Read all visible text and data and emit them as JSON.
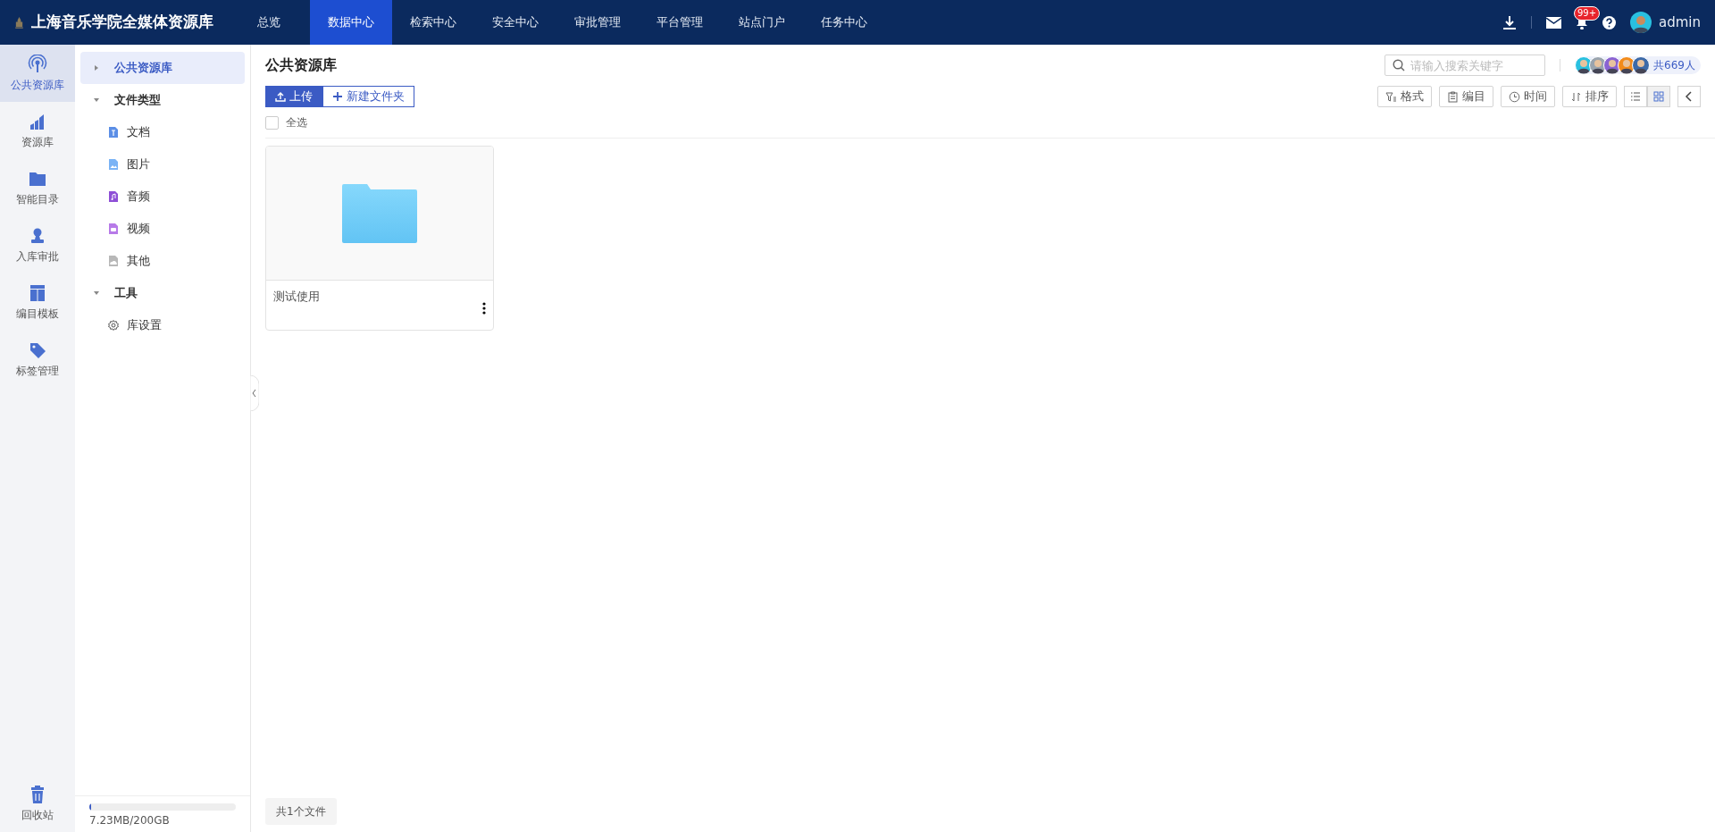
{
  "app": {
    "title": "上海音乐学院全媒体资源库"
  },
  "nav": [
    {
      "label": "总览",
      "selected": false
    },
    {
      "label": "数据中心",
      "selected": true
    },
    {
      "label": "检索中心",
      "selected": false
    },
    {
      "label": "安全中心",
      "selected": false
    },
    {
      "label": "审批管理",
      "selected": false
    },
    {
      "label": "平台管理",
      "selected": false
    },
    {
      "label": "站点门户",
      "selected": false
    },
    {
      "label": "任务中心",
      "selected": false
    }
  ],
  "header_right": {
    "notification_badge": "99+",
    "user": "admin"
  },
  "rail": [
    {
      "label": "公共资源库",
      "kind": "broadcast",
      "selected": true
    },
    {
      "label": "资源库",
      "kind": "chart",
      "selected": false
    },
    {
      "label": "智能目录",
      "kind": "folder",
      "selected": false
    },
    {
      "label": "入库审批",
      "kind": "stamp",
      "selected": false
    },
    {
      "label": "编目模板",
      "kind": "template",
      "selected": false
    },
    {
      "label": "标签管理",
      "kind": "tag",
      "selected": false
    }
  ],
  "rail_bottom": {
    "label": "回收站"
  },
  "tree": [
    {
      "label": "公共资源库",
      "selected": true,
      "expanded": false
    },
    {
      "label": "文件类型",
      "selected": false,
      "expanded": true,
      "children": [
        {
          "label": "文档",
          "kind": "doc",
          "selected": false
        },
        {
          "label": "图片",
          "kind": "image",
          "selected": false
        },
        {
          "label": "音频",
          "kind": "audio",
          "selected": false
        },
        {
          "label": "视频",
          "kind": "video",
          "selected": false
        },
        {
          "label": "其他",
          "kind": "other",
          "selected": false
        }
      ]
    },
    {
      "label": "工具",
      "selected": false,
      "expanded": true,
      "children": [
        {
          "label": "库设置",
          "kind": "gear",
          "selected": false
        }
      ]
    }
  ],
  "storage": {
    "level": 4e-05,
    "reading": "7.23MB/200GB"
  },
  "main": {
    "title": "公共资源库",
    "search": {
      "placeholder": "请输入搜索关键字"
    },
    "members": "共669人",
    "actions": [
      {
        "label": "上传",
        "kind": "upload"
      },
      {
        "label": "新建文件夹",
        "kind": "plus"
      }
    ],
    "select_all": {
      "label": "全选",
      "checked": false
    },
    "tools": [
      {
        "label": "格式",
        "kind": "filter"
      },
      {
        "label": "编目",
        "kind": "clipboard"
      },
      {
        "label": "时间",
        "kind": "clock"
      },
      {
        "label": "排序",
        "kind": "sort"
      }
    ],
    "views": [
      {
        "kind": "list",
        "selected": false
      },
      {
        "kind": "grid",
        "selected": true
      }
    ],
    "files": [
      {
        "name": "测试使用",
        "kind": "folder"
      }
    ],
    "footer": "共1个文件"
  }
}
